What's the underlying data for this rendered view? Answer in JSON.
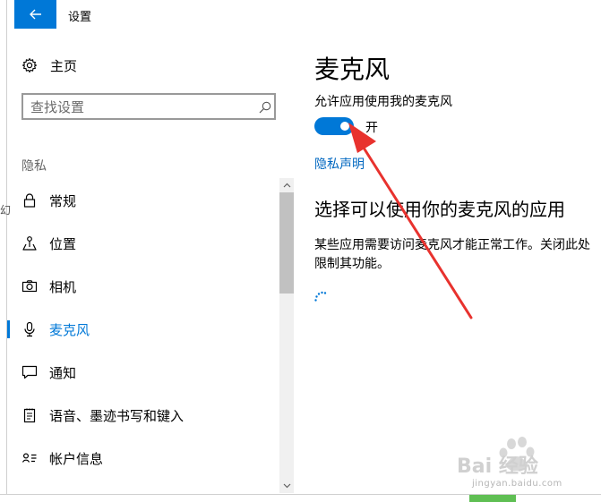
{
  "window": {
    "title": "设置"
  },
  "nav": {
    "home_label": "主页",
    "search_placeholder": "查找设置",
    "section_label": "隐私",
    "items": [
      {
        "label": "常规",
        "icon": "lock-icon"
      },
      {
        "label": "位置",
        "icon": "location-icon"
      },
      {
        "label": "相机",
        "icon": "camera-icon"
      },
      {
        "label": "麦克风",
        "icon": "microphone-icon",
        "active": true
      },
      {
        "label": "通知",
        "icon": "notification-icon"
      },
      {
        "label": "语音、墨迹书写和键入",
        "icon": "speech-icon"
      },
      {
        "label": "帐户信息",
        "icon": "account-info-icon"
      }
    ]
  },
  "content": {
    "title": "麦克风",
    "allow_label": "允许应用使用我的麦克风",
    "toggle_on": true,
    "toggle_state": "开",
    "privacy_link": "隐私声明",
    "subheading": "选择可以使用你的麦克风的应用",
    "description": "某些应用需要访问麦克风才能正常工作。关闭此处限制其功能。"
  },
  "watermark": {
    "logo_text": "Bai 经验",
    "url": "jingyan.baidu.com"
  },
  "colors": {
    "accent": "#0078d7",
    "link": "#0067c0",
    "annotation_arrow": "#e8322e"
  }
}
